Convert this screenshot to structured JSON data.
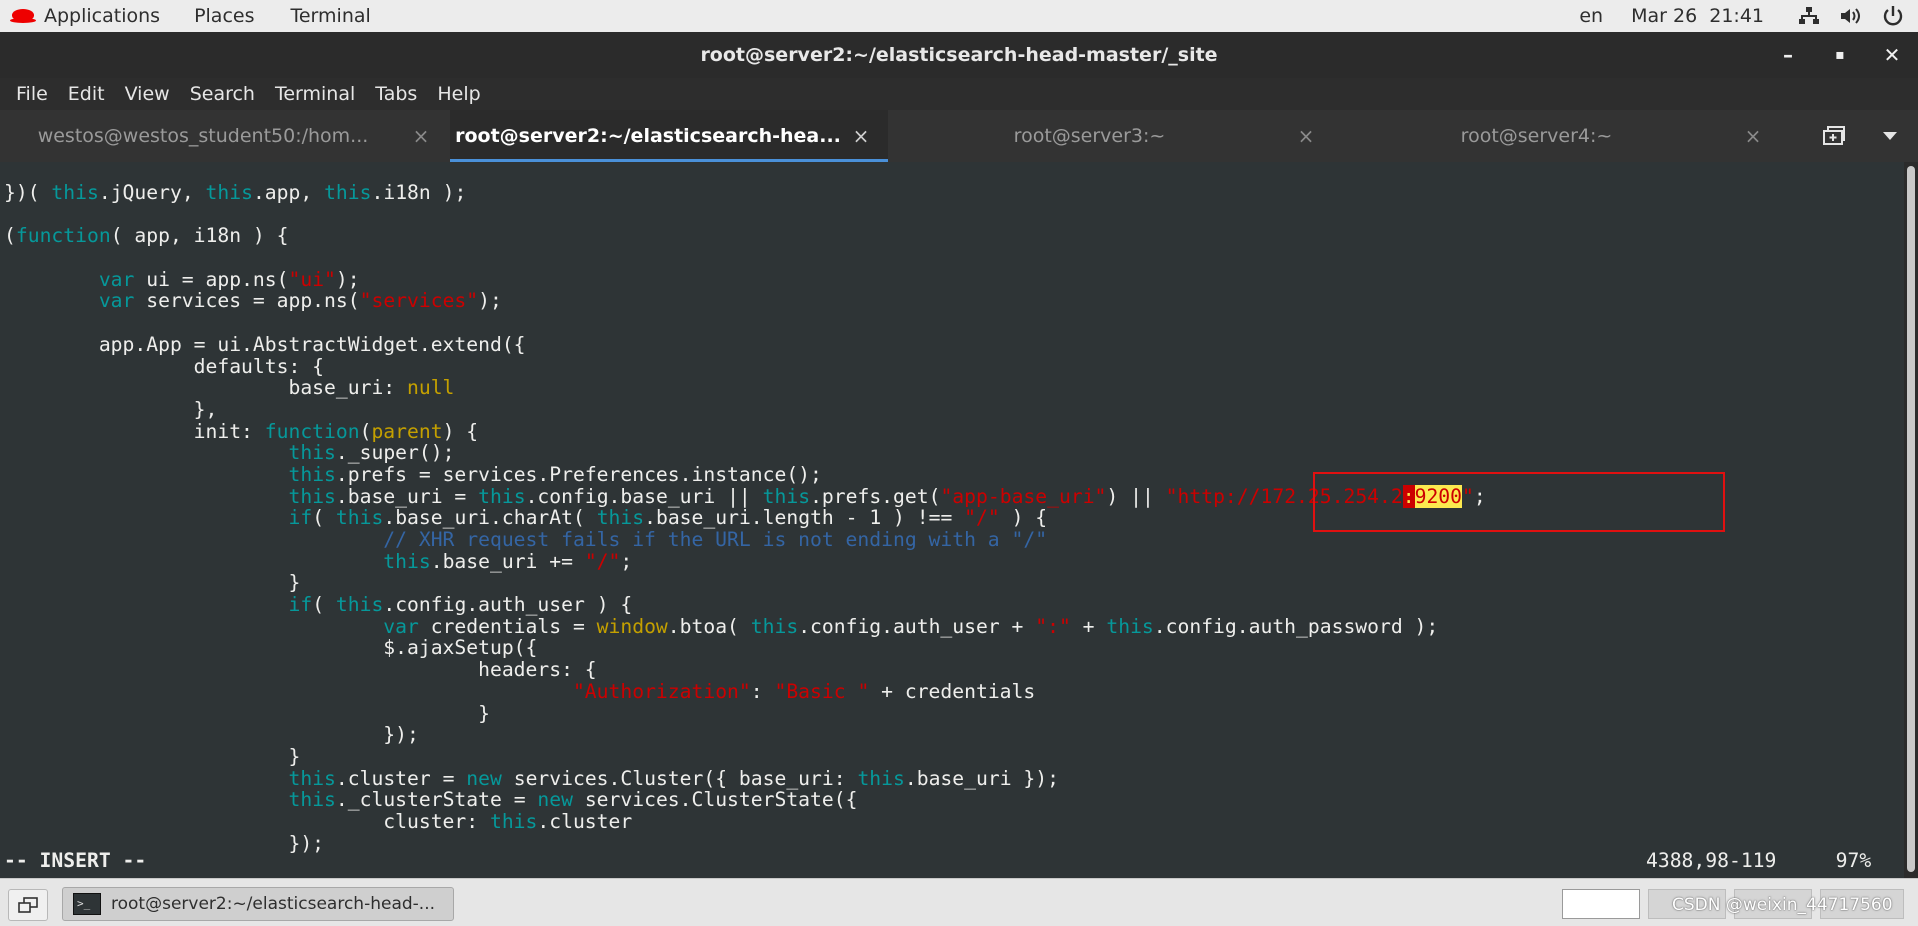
{
  "topbar": {
    "applications": "Applications",
    "places": "Places",
    "terminal": "Terminal",
    "lang": "en",
    "datetime": "Mar 26  21:41",
    "icons": [
      "network-icon",
      "volume-icon",
      "power-icon"
    ]
  },
  "window": {
    "title": "root@server2:~/elasticsearch-head-master/_site",
    "minimize": "–",
    "maximize": "▪",
    "close": "✕"
  },
  "menubar": [
    "File",
    "Edit",
    "View",
    "Search",
    "Terminal",
    "Tabs",
    "Help"
  ],
  "tabs": [
    {
      "label": "westos@westos_student50:/hom...",
      "active": false
    },
    {
      "label": "root@server2:~/elasticsearch-hea...",
      "active": true
    },
    {
      "label": "root@server3:~",
      "active": false
    },
    {
      "label": "root@server4:~",
      "active": false
    }
  ],
  "tab_close": "×",
  "editor": {
    "mode": "-- INSERT --",
    "position": "4388,98-119",
    "percent": "97%"
  },
  "taskbar": {
    "task_label": "root@server2:~/elasticsearch-head-...",
    "watermark": "CSDN @weixin_44717560"
  },
  "colors": {
    "terminal_bg": "#2e3436",
    "keyword": "#06989a",
    "string": "#cc0000",
    "comment": "#3465a4",
    "identifier": "#c4a000",
    "search_highlight": "#fce94f",
    "annotation_box": "#e01010"
  }
}
